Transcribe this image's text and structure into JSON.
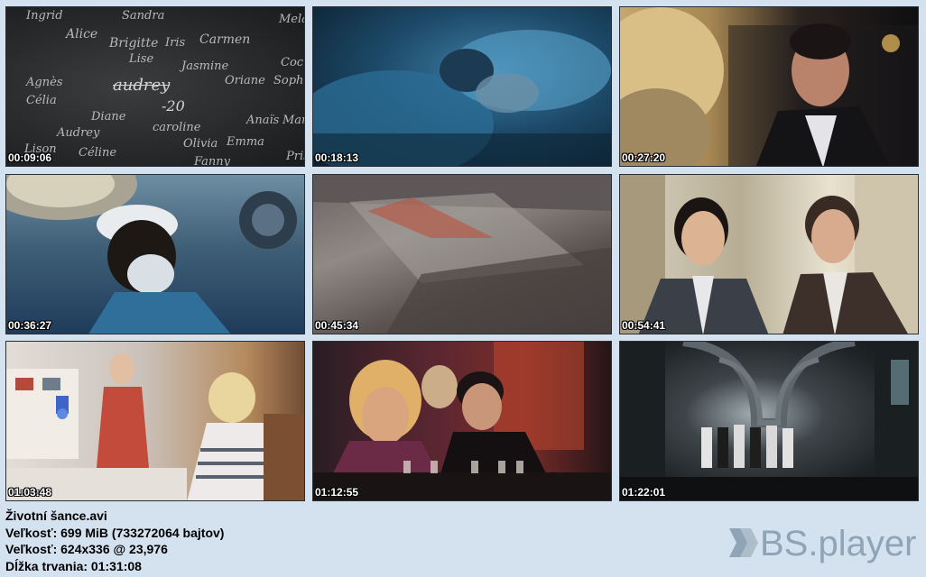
{
  "thumbnails": [
    {
      "timestamp": "00:09:06"
    },
    {
      "timestamp": "00:18:13"
    },
    {
      "timestamp": "00:27:20"
    },
    {
      "timestamp": "00:36:27"
    },
    {
      "timestamp": "00:45:34"
    },
    {
      "timestamp": "00:54:41"
    },
    {
      "timestamp": "01:03:48"
    },
    {
      "timestamp": "01:12:55"
    },
    {
      "timestamp": "01:22:01"
    }
  ],
  "chalk_names": [
    "Ingrid",
    "Sandra",
    "Alice",
    "Brigitte",
    "Iris",
    "Carmen",
    "Lise",
    "Jasmine",
    "Agnès",
    "Célia",
    "audrey",
    "-20",
    "Oriane",
    "Sophie",
    "Diane",
    "caroline",
    "Audrey",
    "Olivia",
    "Emma",
    "Céline",
    "Lison",
    "Fanny",
    "Mela",
    "Coc",
    "Anaïs",
    "Mar",
    "Pris"
  ],
  "file_info": {
    "filename": "Životní šance.avi",
    "size_line": "Veľkosť: 699 MiB (733272064 bajtov)",
    "resolution_line": "Veľkosť: 624x336 @ 23,976",
    "duration_line": "Dĺžka trvania: 01:31:08"
  },
  "logo": {
    "text": "BS.player",
    "color": "#8fa4b6"
  }
}
